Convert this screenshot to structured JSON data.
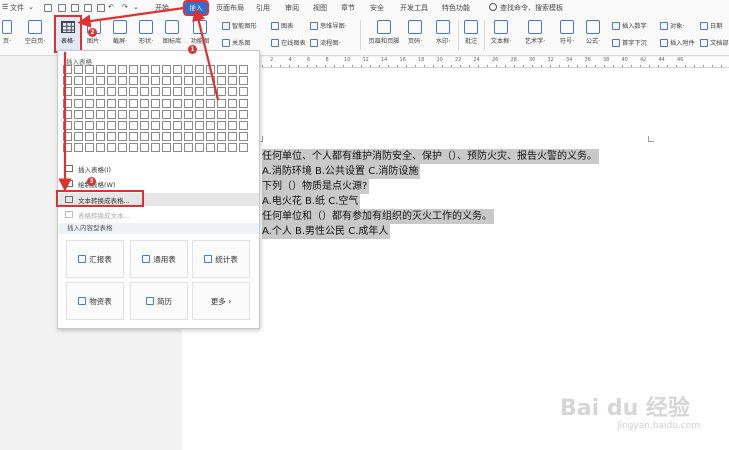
{
  "menubar": {
    "file_label": "文件",
    "start_tab": "开始",
    "tabs": [
      "插入",
      "页面布局",
      "引用",
      "审阅",
      "视图",
      "章节",
      "安全",
      "开发工具",
      "特色功能"
    ],
    "search_placeholder": "查找命令、搜索模板"
  },
  "ribbon": {
    "left_items": [
      "页·",
      "空白页·"
    ],
    "table_label": "表格·",
    "picture_label": "图片·",
    "screenshot_label": "截屏·",
    "shape_label": "形状·",
    "icon_lib_label": "图标库",
    "func_chart_label": "功能图",
    "smart_graphic": "智能图形",
    "chart": "图表",
    "mind_map": "思维导图·",
    "relation": "关系图",
    "online_chart": "在线图表",
    "flow_chart": "流程图·",
    "header_footer": "页眉和页脚",
    "page_number": "页码·",
    "watermark": "水印·",
    "comment": "批注",
    "textbox": "文本框·",
    "art_text": "艺术字·",
    "symbol": "符号·",
    "formula": "公式·",
    "insert_number": "插入数字",
    "object": "对象·",
    "date": "日期",
    "first_letter": "首字下沉",
    "attachment": "插入附件",
    "doc_part": "文档部"
  },
  "ruler_numbers": [
    "2",
    "4",
    "6",
    "8",
    "10",
    "12",
    "14",
    "16",
    "18",
    "20",
    "22",
    "24",
    "26",
    "28",
    "30",
    "32",
    "34",
    "36",
    "38",
    "40",
    "42",
    "44",
    "46"
  ],
  "panel": {
    "title": "插入表格",
    "grid_cols": 17,
    "grid_rows": 8,
    "menu": {
      "insert_table": "插入表格(I)",
      "draw_table": "绘制表格(W)",
      "text_to_table": "文本转换成表格...",
      "table_to_text": "表格转换成文本..."
    },
    "section_title": "插入内容型表格",
    "cards": [
      "汇报表",
      "通用表",
      "统计表",
      "物资表",
      "简历",
      "更多 ›"
    ]
  },
  "badges": [
    "1",
    "2",
    "3"
  ],
  "document": {
    "lines": [
      "任何单位、个人都有维护消防安全、保护（）、预防火灾、报告火警的义务。",
      "A.消防环境    B.公共设置    C.消防设施",
      "下列（）物质是点火源?",
      "A.电火花    B.纸    C.空气",
      "任何单位和（）都有参加有组织的灭火工作的义务。",
      "A.个人    B.男性公民    C.成年人"
    ]
  },
  "watermark": {
    "brand": "Bai du 经验",
    "url": "jingyan.baidu.com"
  },
  "colors": {
    "accent_red": "#e03131",
    "insert_tab_blue": "#2e6fd6"
  }
}
